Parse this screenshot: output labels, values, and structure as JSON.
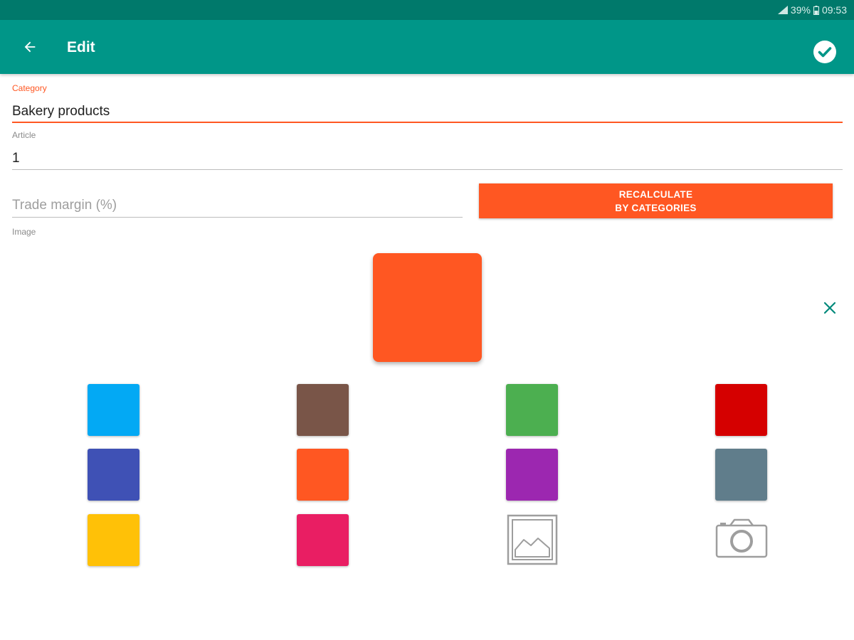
{
  "status_bar": {
    "battery": "39%",
    "time": "09:53"
  },
  "header": {
    "title": "Edit"
  },
  "form": {
    "category_label": "Category",
    "category_value": "Bakery products",
    "article_label": "Article",
    "article_value": "1",
    "margin_placeholder": "Trade margin (%)",
    "recalc_line1": "RECALCULATE",
    "recalc_line2": "BY CATEGORIES",
    "image_label": "Image"
  },
  "image": {
    "selected_color": "#ff5722",
    "swatches": [
      "#03a9f4",
      "#795548",
      "#4caf50",
      "#d50000",
      "#3f51b5",
      "#ff5722",
      "#9c27b0",
      "#607d8b",
      "#ffc107",
      "#e91e63"
    ]
  },
  "colors": {
    "primary": "#009688",
    "primary_dark": "#00796b",
    "accent": "#ff5722"
  }
}
